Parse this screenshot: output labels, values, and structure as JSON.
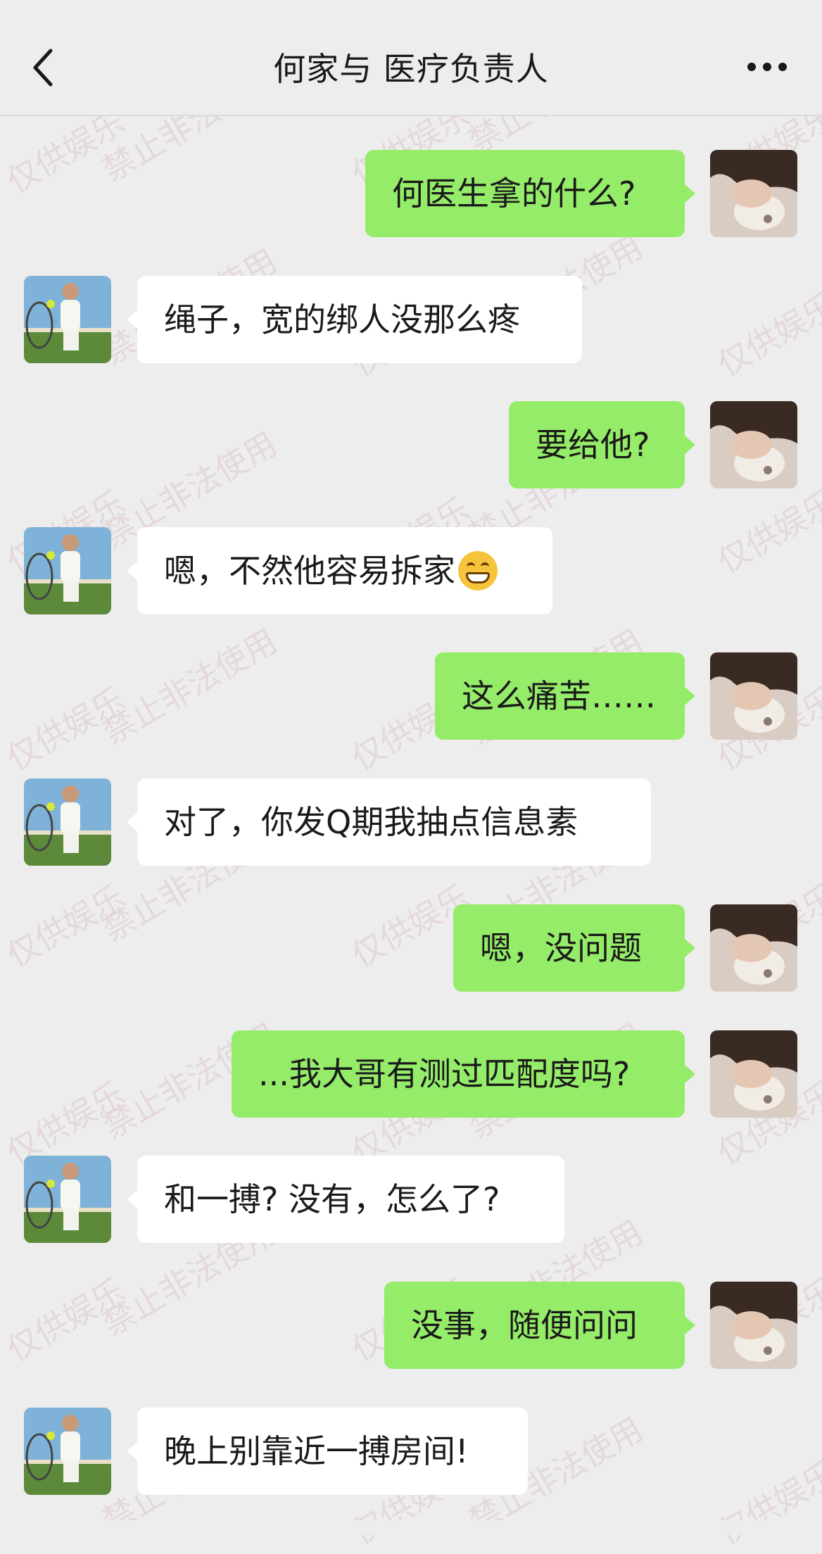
{
  "header": {
    "title": "何家与 医疗负责人",
    "back_icon": "chevron-left-icon",
    "more_icon": "more-dots-icon"
  },
  "watermark": {
    "texts": [
      "仅供娱乐",
      "禁止非法使用"
    ]
  },
  "messages": [
    {
      "sender": "me",
      "text": "何医生拿的什么?"
    },
    {
      "sender": "other",
      "text": "绳子，宽的绑人没那么疼"
    },
    {
      "sender": "me",
      "text": "要给他?"
    },
    {
      "sender": "other",
      "text": "嗯，不然他容易拆家",
      "emoji": "grinning-face-icon"
    },
    {
      "sender": "me",
      "text": "这么痛苦……"
    },
    {
      "sender": "other",
      "text": "对了，你发Q期我抽点信息素"
    },
    {
      "sender": "me",
      "text": "嗯，没问题"
    },
    {
      "sender": "me",
      "text": "...我大哥有测过匹配度吗?"
    },
    {
      "sender": "other",
      "text": "和一搏? 没有，怎么了?"
    },
    {
      "sender": "me",
      "text": "没事，随便问问"
    },
    {
      "sender": "other",
      "text": "晚上别靠近一搏房间!"
    }
  ],
  "colors": {
    "background": "#ededed",
    "my_bubble": "#95ec69",
    "other_bubble": "#ffffff"
  }
}
